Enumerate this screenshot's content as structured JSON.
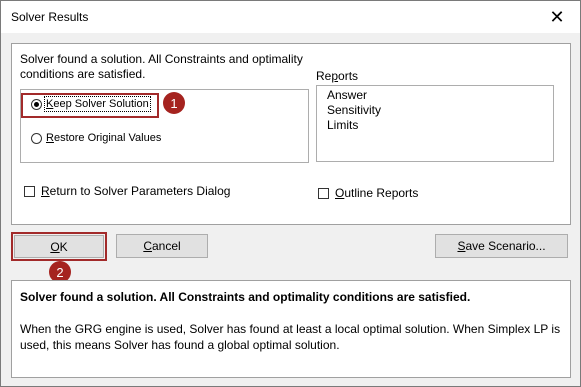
{
  "window": {
    "title": "Solver Results",
    "close_glyph": "✕"
  },
  "message": "Solver found a solution.  All Constraints and optimality conditions are satisfied.",
  "options": {
    "keep": {
      "prefix": "",
      "accel": "K",
      "rest": "eep Solver Solution",
      "checked": true
    },
    "restore": {
      "accel": "R",
      "rest": "estore Original Values",
      "checked": false
    }
  },
  "reports": {
    "label_pre": "Re",
    "label_accel": "p",
    "label_rest": "orts",
    "items": [
      "Answer",
      "Sensitivity",
      "Limits"
    ]
  },
  "checkboxes": {
    "return_dialog": {
      "accel": "R",
      "rest": "eturn to Solver Parameters Dialog",
      "checked": false
    },
    "outline": {
      "accel": "O",
      "rest": "utline Reports",
      "checked": false
    }
  },
  "buttons": {
    "ok": {
      "accel": "O",
      "rest": "K"
    },
    "cancel": {
      "accel": "C",
      "rest": "ancel"
    },
    "save_pre": "",
    "save": {
      "accel": "S",
      "rest": "ave Scenario..."
    }
  },
  "markers": [
    "1",
    "2"
  ],
  "result": {
    "title": "Solver found a solution.  All Constraints and optimality conditions are satisfied.",
    "description": "When the GRG engine is used, Solver has found at least a local optimal solution. When Simplex LP is used, this means Solver has found a global optimal solution."
  },
  "colors": {
    "marker": "#a5231f",
    "highlight": "#a22a2a"
  }
}
